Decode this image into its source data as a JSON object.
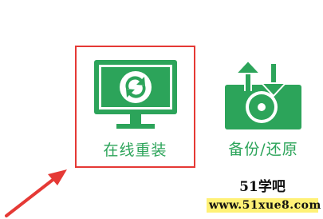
{
  "tiles": [
    {
      "label": "在线重装",
      "icon": "monitor-refresh-icon",
      "selected": true
    },
    {
      "label": "备份/还原",
      "icon": "disk-backup-restore-icon",
      "selected": false
    }
  ],
  "annotation": {
    "icon": "red-pointer-arrow-icon"
  },
  "watermark": {
    "title": "51学吧",
    "url": "www.51xue8.com"
  },
  "colors": {
    "accent_green": "#2ca45a",
    "selection_red": "#e53935",
    "watermark_highlight": "#fff176"
  }
}
